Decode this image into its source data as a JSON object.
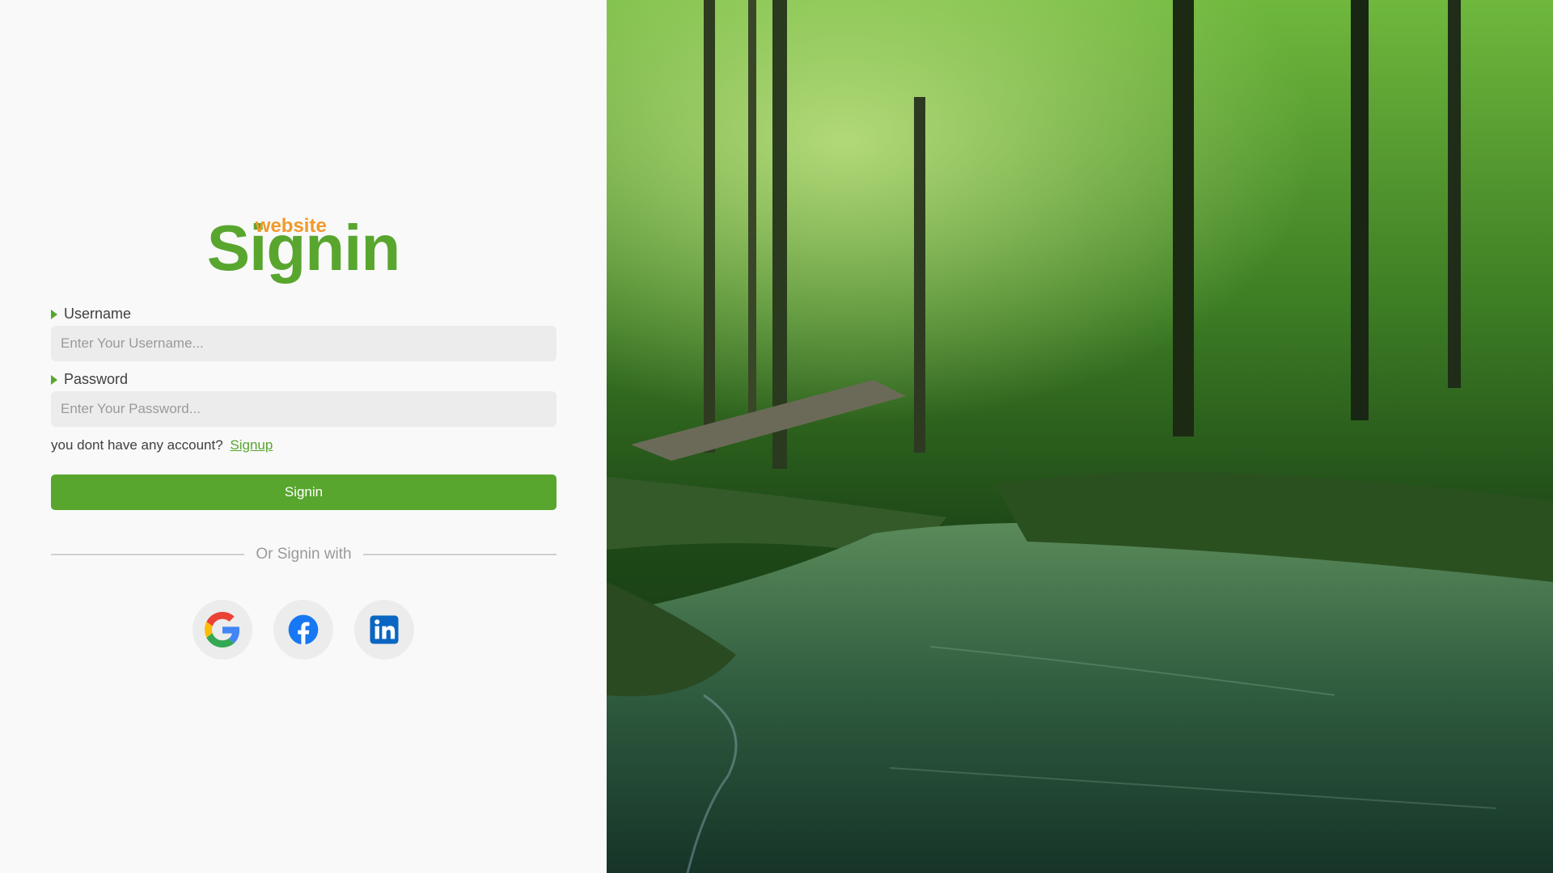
{
  "brand": {
    "title": "Signin",
    "subtitle": "website",
    "title_color": "#58a62e",
    "subtitle_color": "#f19a2c"
  },
  "form": {
    "username_label": "Username",
    "username_placeholder": "Enter Your Username...",
    "password_label": "Password",
    "password_placeholder": "Enter Your Password...",
    "signup_prompt": "you dont have any account?",
    "signup_link": "Signup",
    "submit_label": "Signin"
  },
  "divider": {
    "text": "Or Signin with"
  },
  "social": [
    {
      "name": "google",
      "icon": "google-icon"
    },
    {
      "name": "facebook",
      "icon": "facebook-icon"
    },
    {
      "name": "linkedin",
      "icon": "linkedin-icon"
    }
  ],
  "hero_image": {
    "subject": "forest-stream-photo"
  },
  "colors": {
    "accent": "#58a62e",
    "background": "#f9f9f9",
    "input_background": "#ececec"
  }
}
